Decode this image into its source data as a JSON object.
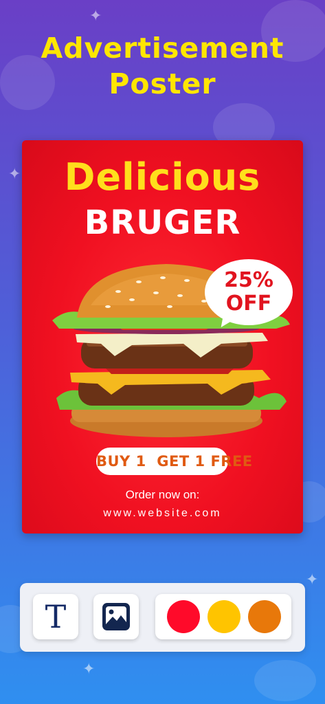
{
  "heading": {
    "line1": "Advertisement",
    "line2": "Poster"
  },
  "poster": {
    "title_line1": "Delicious",
    "title_line2": "BRUGER",
    "discount_line1": "25%",
    "discount_line2": "OFF",
    "offer_label": "BUY 1  GET 1 FREE",
    "order_text": "Order now on:",
    "website": "www.website.com",
    "image": "burger-image"
  },
  "toolbar": {
    "text_tool_glyph": "T",
    "image_tool_icon": "image-icon",
    "colors": [
      "#ff0a2a",
      "#ffc400",
      "#e8780a"
    ]
  }
}
